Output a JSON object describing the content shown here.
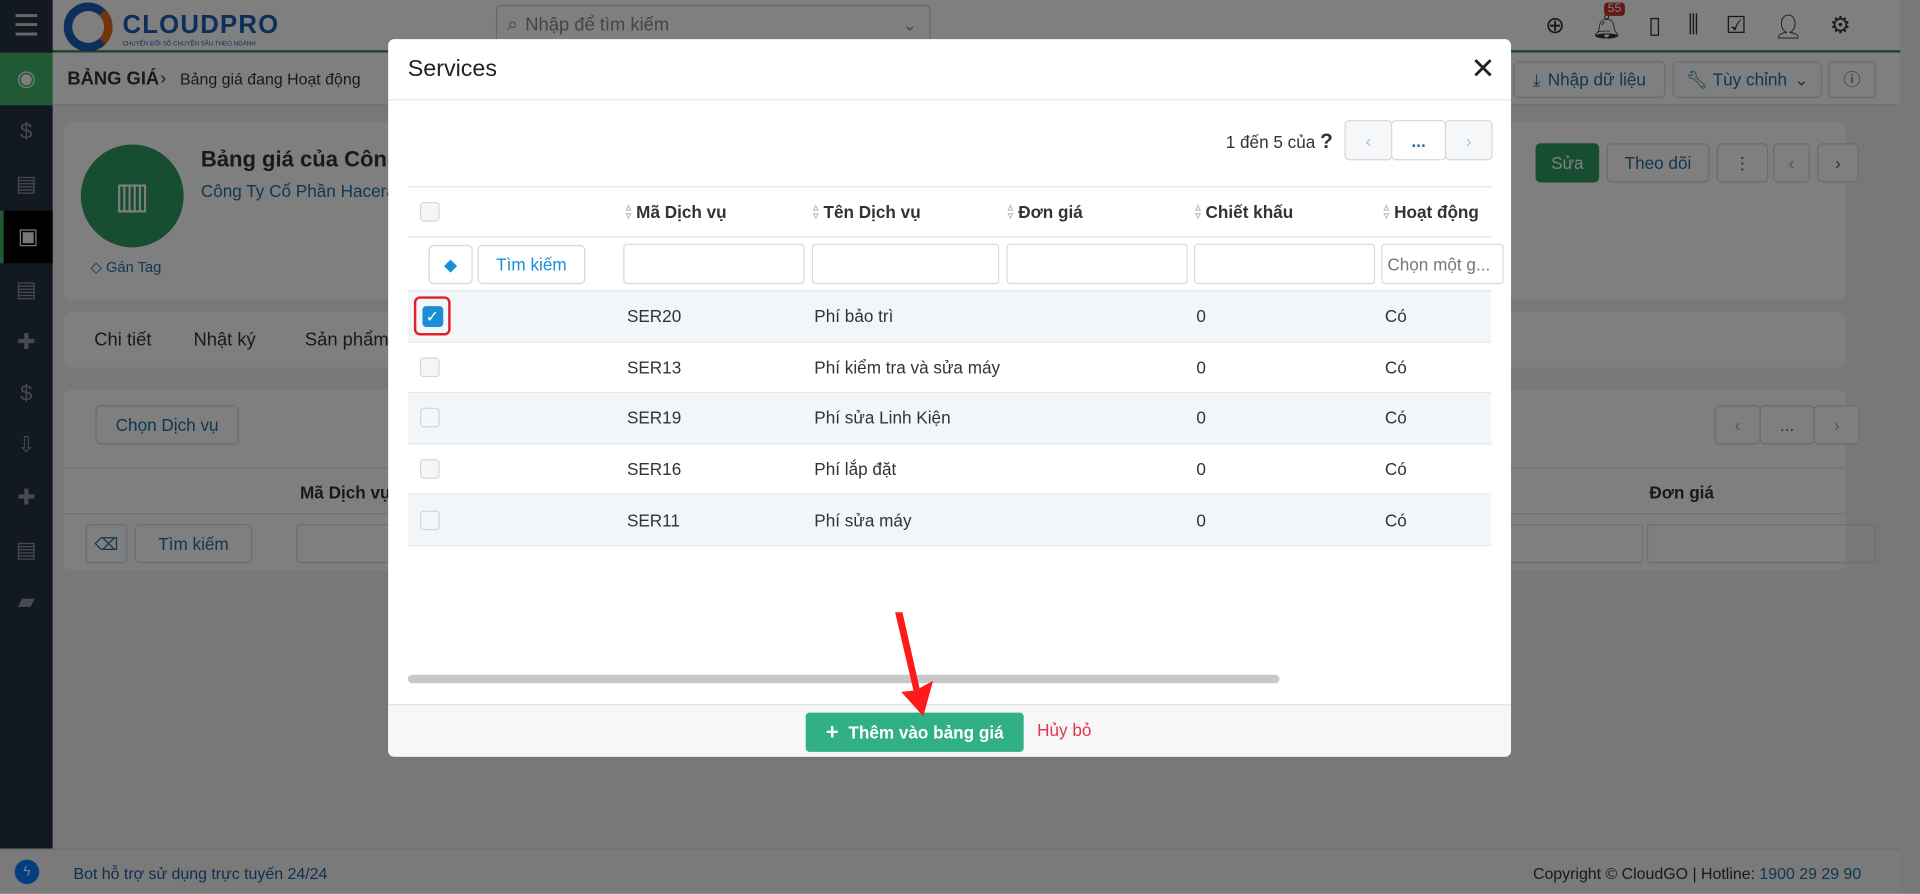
{
  "header": {
    "logo": "CLOUDPRO",
    "logo_tagline": "CHUYỂN ĐỔI SỐ CHUYÊN SÂU THEO NGÀNH",
    "search_placeholder": "Nhập để tìm kiếm",
    "notification_count": "55"
  },
  "breadcrumb": {
    "module": "BẢNG GIÁ",
    "view": "Bảng giá đang Hoạt động"
  },
  "toolbar": {
    "import": "Nhập dữ liệu",
    "customize": "Tùy chỉnh"
  },
  "record": {
    "title": "Bảng giá của Công",
    "company": "Công Ty Cổ Phần Hacera",
    "tag": "Gán Tag",
    "edit": "Sửa",
    "follow": "Theo dõi"
  },
  "tabs": [
    "Chi tiết",
    "Nhật ký",
    "Sản phẩm"
  ],
  "services_panel": {
    "choose": "Chọn Dịch vụ",
    "col_code": "Mã Dịch vụ",
    "col_price": "Đơn giá",
    "search": "Tìm kiếm",
    "pager_more": "..."
  },
  "modal": {
    "title": "Services",
    "pager_text": "1 đến 5 của",
    "pager_total": "?",
    "pager_more": "...",
    "columns": [
      "Mã Dịch vụ",
      "Tên Dịch vụ",
      "Đơn giá",
      "Chiết khấu",
      "Hoạt động"
    ],
    "search": "Tìm kiếm",
    "active_placeholder": "Chọn một g...",
    "rows": [
      {
        "code": "SER20",
        "name": "Phí bảo trì",
        "price": "",
        "discount": "0",
        "active": "Có",
        "checked": true
      },
      {
        "code": "SER13",
        "name": "Phí kiểm tra và sửa máy",
        "price": "",
        "discount": "0",
        "active": "Có",
        "checked": false
      },
      {
        "code": "SER19",
        "name": "Phí sửa Linh Kiện",
        "price": "",
        "discount": "0",
        "active": "Có",
        "checked": false
      },
      {
        "code": "SER16",
        "name": "Phí lắp đặt",
        "price": "",
        "discount": "0",
        "active": "Có",
        "checked": false
      },
      {
        "code": "SER11",
        "name": "Phí sửa máy",
        "price": "",
        "discount": "0",
        "active": "Có",
        "checked": false
      }
    ],
    "add_button": "Thêm vào bảng giá",
    "cancel": "Hủy bỏ"
  },
  "footer": {
    "bot": "Bot hỗ trợ sử dụng trực tuyến 24/24",
    "copyright": "Copyright © CloudGO",
    "hotline_label": "Hotline:",
    "hotline": "1900 29 29 90"
  },
  "colors": {
    "brand_green": "#2e9d62",
    "add_button": "#31b083",
    "cancel": "#e0344f",
    "check_blue": "#1a8fd6",
    "annotation_arrow": "#ff0000"
  }
}
